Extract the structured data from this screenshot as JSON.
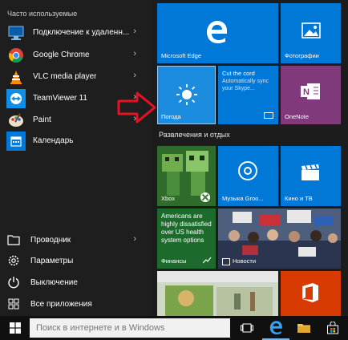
{
  "start_menu": {
    "most_used_title": "Часто используемые",
    "apps": [
      {
        "label": "Подключение к удаленн...",
        "icon": "remote-desktop-icon",
        "has_chevron": true
      },
      {
        "label": "Google Chrome",
        "icon": "chrome-icon",
        "has_chevron": true
      },
      {
        "label": "VLC media player",
        "icon": "vlc-icon",
        "has_chevron": true
      },
      {
        "label": "TeamViewer 11",
        "icon": "teamviewer-icon",
        "has_chevron": true
      },
      {
        "label": "Paint",
        "icon": "paint-icon",
        "has_chevron": true
      },
      {
        "label": "Календарь",
        "icon": "calendar-icon",
        "has_chevron": false
      }
    ],
    "system": [
      {
        "label": "Проводник",
        "icon": "explorer-icon",
        "has_chevron": true
      },
      {
        "label": "Параметры",
        "icon": "settings-icon",
        "has_chevron": false
      },
      {
        "label": "Выключение",
        "icon": "power-icon",
        "has_chevron": false
      },
      {
        "label": "Все приложения",
        "icon": "all-apps-icon",
        "has_chevron": false
      }
    ]
  },
  "tiles": {
    "edge_label": "Microsoft Edge",
    "photos_label": "Фотографии",
    "weather_label": "Погода",
    "cutcord_title": "Cut the cord",
    "cutcord_text": "Automatically sync your Skype...",
    "onenote_label": "OneNote",
    "group_title": "Развлечения и отдых",
    "xbox_label": "Xbox",
    "groove_label": "Музыка Groo...",
    "movies_label": "Кино и ТВ",
    "finance_headline": "Americans are highly dissatisfied over US health system options",
    "finance_label": "Финансы",
    "news_label": "Новости"
  },
  "taskbar": {
    "search_placeholder": "Поиск в интернете и в Windows"
  },
  "colors": {
    "tile_blue": "#0078d7",
    "onenote_purple": "#80397b",
    "office_red": "#d83b01",
    "arrow_red": "#e81123"
  }
}
